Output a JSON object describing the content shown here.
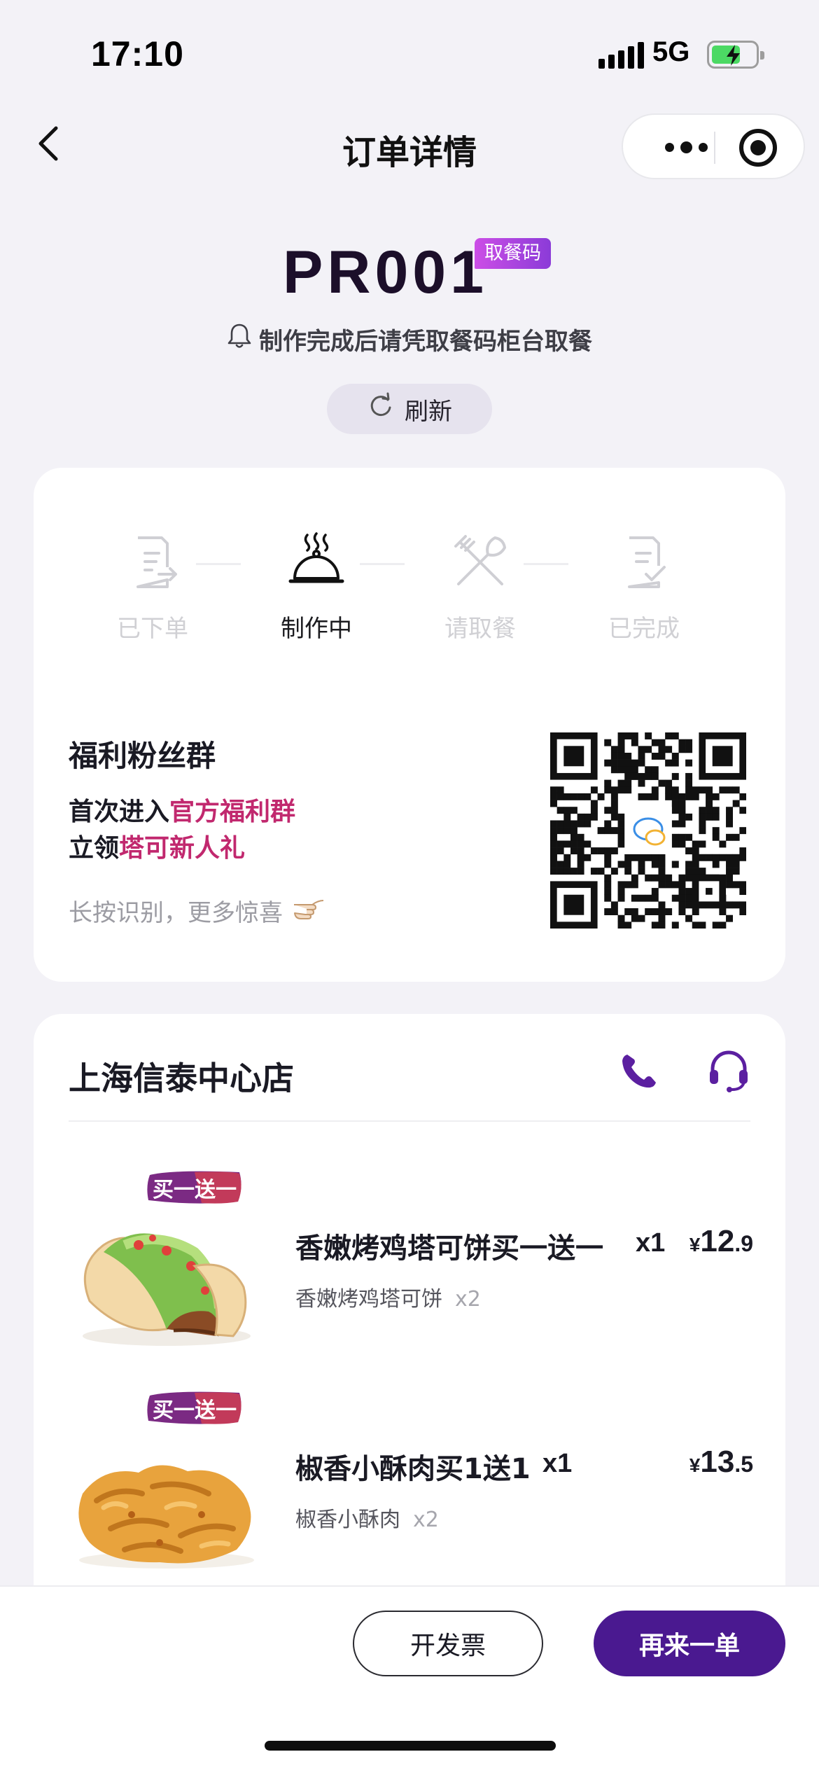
{
  "status_bar": {
    "time": "17:10",
    "network": "5G"
  },
  "nav": {
    "title": "订单详情"
  },
  "pickup": {
    "code": "PR001",
    "badge": "取餐码",
    "hint": "制作完成后请凭取餐码柜台取餐",
    "refresh_label": "刷新"
  },
  "progress": {
    "steps": [
      {
        "label": "已下单",
        "state": "inactive"
      },
      {
        "label": "制作中",
        "state": "active"
      },
      {
        "label": "请取餐",
        "state": "inactive"
      },
      {
        "label": "已完成",
        "state": "inactive"
      }
    ]
  },
  "welfare": {
    "title": "福利粉丝群",
    "line1_prefix": "首次进入",
    "line1_highlight": "官方福利群",
    "line2_prefix": "立领",
    "line2_highlight": "塔可新人礼",
    "tip": "长按识别，更多惊喜"
  },
  "store": {
    "name": "上海信泰中心店",
    "items": [
      {
        "tag": "买一送一",
        "name": "香嫩烤鸡塔可饼买一送一",
        "qty": "x1",
        "price_currency": "¥",
        "price_int": "12",
        "price_dec": ".9",
        "sub_name": "香嫩烤鸡塔可饼",
        "sub_qty": "x2"
      },
      {
        "tag": "买一送一",
        "name": "椒香小酥肉买1送1",
        "qty": "x1",
        "price_currency": "¥",
        "price_int": "13",
        "price_dec": ".5",
        "sub_name": "椒香小酥肉",
        "sub_qty": "x2"
      }
    ]
  },
  "actions": {
    "invoice_label": "开发票",
    "reorder_label": "再来一单"
  },
  "colors": {
    "brand_purple": "#4a1990",
    "highlight_pink": "#c1286e",
    "badge_gradient_start": "#cc4ee6",
    "battery_green": "#4cd964"
  },
  "icons": [
    "back-chevron-icon",
    "more-dots-icon",
    "target-icon",
    "bell-icon",
    "refresh-icon",
    "order-placed-icon",
    "cloche-icon",
    "utensils-icon",
    "completed-icon",
    "qr-code",
    "pointing-hand-icon",
    "phone-icon",
    "headset-icon"
  ]
}
